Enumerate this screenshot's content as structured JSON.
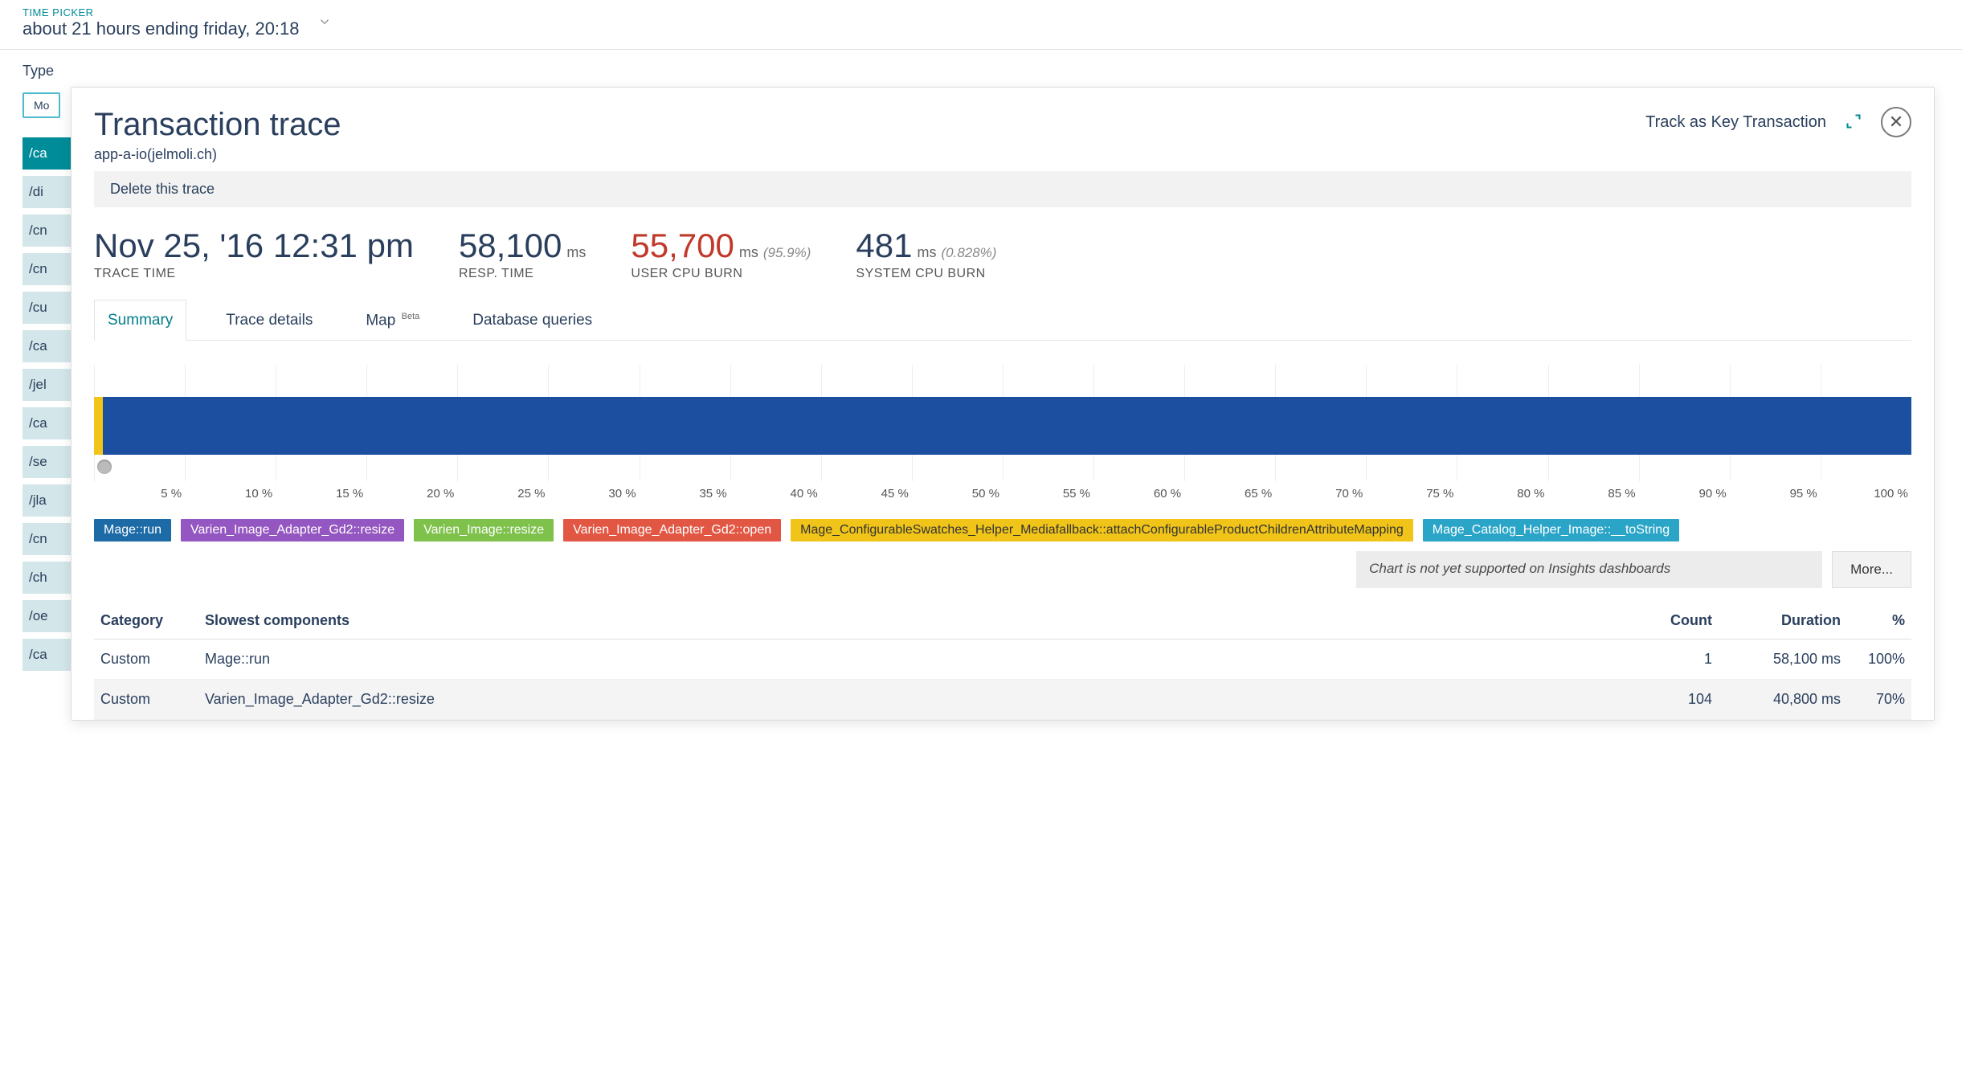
{
  "time_picker": {
    "label": "TIME PICKER",
    "value": "about 21 hours ending friday, 20:18"
  },
  "bg": {
    "type_label": "Type",
    "tag": "Mo",
    "items": [
      "/ca",
      "/di",
      "/cn",
      "/cn",
      "/cu",
      "/ca",
      "/jel",
      "/ca",
      "/se",
      "/jla",
      "/cn",
      "/ch",
      "/oe",
      "/ca"
    ],
    "active_index": 0
  },
  "modal": {
    "title": "Transaction trace",
    "subtitle": "app-a-io(jelmoli.ch)",
    "key_tx": "Track as Key Transaction",
    "delete_trace": "Delete this trace"
  },
  "metrics": {
    "trace_time": {
      "value": "Nov 25, '16 12:31 pm",
      "label": "TRACE TIME"
    },
    "resp_time": {
      "value": "58,100",
      "unit": "ms",
      "label": "RESP. TIME"
    },
    "cpu_burn": {
      "value": "55,700",
      "unit": "ms",
      "pct": "(95.9%)",
      "label": "USER CPU BURN"
    },
    "sys_cpu": {
      "value": "481",
      "unit": "ms",
      "pct": "(0.828%)",
      "label": "SYSTEM CPU BURN"
    }
  },
  "tabs": {
    "summary": "Summary",
    "details": "Trace details",
    "map": "Map",
    "map_badge": "Beta",
    "db": "Database queries"
  },
  "chart_data": {
    "type": "bar",
    "xlabel": "",
    "ylabel": "",
    "x_unit": "%",
    "x_ticks": [
      "5 %",
      "10 %",
      "15 %",
      "20 %",
      "25 %",
      "30 %",
      "35 %",
      "40 %",
      "45 %",
      "50 %",
      "55 %",
      "60 %",
      "65 %",
      "70 %",
      "75 %",
      "80 %",
      "85 %",
      "90 %",
      "95 %",
      "100 %"
    ],
    "series": [
      {
        "name": "Mage::run",
        "color": "#1c6aa6",
        "start_pct": 0,
        "width_pct": 100
      },
      {
        "name": "Varien_Image_Adapter_Gd2::resize",
        "color": "#9456c0",
        "start_pct": 0,
        "width_pct": 70
      },
      {
        "name": "Varien_Image::resize",
        "color": "#7ec14b",
        "start_pct": 0,
        "width_pct": 0
      },
      {
        "name": "Varien_Image_Adapter_Gd2::open",
        "color": "#e25744",
        "start_pct": 0,
        "width_pct": 0
      },
      {
        "name": "Mage_ConfigurableSwatches_Helper_Mediafallback::attachConfigurableProductChildrenAttributeMapping",
        "color": "#f0c419",
        "start_pct": 0,
        "width_pct": 0
      },
      {
        "name": "Mage_Catalog_Helper_Image::__toString",
        "color": "#2aa5c7",
        "start_pct": 0,
        "width_pct": 0
      }
    ]
  },
  "legend": [
    {
      "label": "Mage::run",
      "cls": "blue"
    },
    {
      "label": "Varien_Image_Adapter_Gd2::resize",
      "cls": "purple"
    },
    {
      "label": "Varien_Image::resize",
      "cls": "green"
    },
    {
      "label": "Varien_Image_Adapter_Gd2::open",
      "cls": "red"
    },
    {
      "label": "Mage_ConfigurableSwatches_Helper_Mediafallback::attachConfigurableProductChildrenAttributeMapping",
      "cls": "yellow"
    },
    {
      "label": "Mage_Catalog_Helper_Image::__toString",
      "cls": "cyan"
    }
  ],
  "insights": {
    "note": "Chart is not yet supported on Insights dashboards",
    "more": "More..."
  },
  "table": {
    "headers": {
      "category": "Category",
      "component": "Slowest components",
      "count": "Count",
      "duration": "Duration",
      "pct": "%"
    },
    "rows": [
      {
        "category": "Custom",
        "component": "Mage::run",
        "count": "1",
        "duration": "58,100 ms",
        "pct": "100%"
      },
      {
        "category": "Custom",
        "component": "Varien_Image_Adapter_Gd2::resize",
        "count": "104",
        "duration": "40,800 ms",
        "pct": "70%"
      }
    ]
  }
}
